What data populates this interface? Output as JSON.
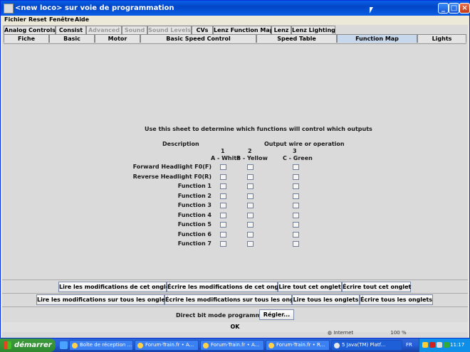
{
  "window": {
    "title": "<new loco> sur voie de programmation",
    "menu": [
      "Fichier",
      "Reset",
      "Fenêtre",
      "Aide"
    ]
  },
  "tabs_row1": [
    {
      "label": "Analog Controls",
      "disabled": false
    },
    {
      "label": "Consist",
      "disabled": false
    },
    {
      "label": "Advanced",
      "disabled": true
    },
    {
      "label": "Sound",
      "disabled": true
    },
    {
      "label": "Sound Levels",
      "disabled": true
    },
    {
      "label": "CVs",
      "disabled": false
    },
    {
      "label": "Lenz Function Map",
      "disabled": false
    },
    {
      "label": "Lenz",
      "disabled": false
    },
    {
      "label": "Lenz Lighting",
      "disabled": false
    }
  ],
  "tabs_row2": [
    {
      "label": "Fiche"
    },
    {
      "label": "Basic"
    },
    {
      "label": "Motor"
    },
    {
      "label": "Basic Speed Control"
    },
    {
      "label": "Speed Table"
    },
    {
      "label": "Function Map",
      "selected": true
    },
    {
      "label": "Lights"
    }
  ],
  "function_map": {
    "instruction": "Use this sheet to determine which functions will control which outputs",
    "description_header": "Description",
    "output_header": "Output wire or operation",
    "columns": [
      {
        "number": "1",
        "label": "A - White"
      },
      {
        "number": "2",
        "label": "B - Yellow"
      },
      {
        "number": "3",
        "label": "C - Green"
      }
    ],
    "rows": [
      {
        "label": "Forward Headlight F0(F)",
        "checks": [
          false,
          false,
          false
        ]
      },
      {
        "label": "Reverse Headlight F0(R)",
        "checks": [
          false,
          false,
          false
        ]
      },
      {
        "label": "Function 1",
        "checks": [
          false,
          false,
          false
        ]
      },
      {
        "label": "Function 2",
        "checks": [
          false,
          false,
          false
        ]
      },
      {
        "label": "Function 3",
        "checks": [
          false,
          false,
          false
        ]
      },
      {
        "label": "Function 4",
        "checks": [
          false,
          false,
          false
        ]
      },
      {
        "label": "Function 5",
        "checks": [
          false,
          false,
          false
        ]
      },
      {
        "label": "Function 6",
        "checks": [
          false,
          false,
          false
        ]
      },
      {
        "label": "Function 7",
        "checks": [
          false,
          false,
          false
        ]
      }
    ]
  },
  "buttons": {
    "row1": [
      "Lire les modifications de cet onglet",
      "Écrire les modifications de cet onglet",
      "Lire tout cet onglet",
      "Écrire tout cet onglet"
    ],
    "row2": [
      "Lire les modifications sur tous les onglets",
      "Écrire les modifications sur tous les onglets",
      "Lire tous les onglets",
      "Écrire tous les onglets"
    ],
    "mode_label": "Direct bit mode programming",
    "regler": "Régler...",
    "ok": "OK"
  },
  "taskbar": {
    "start": "démarrer",
    "tasks": [
      "Boîte de réception ...",
      "Forum-Train.fr • A...",
      "Forum-Train.fr • A...",
      "Forum-Train.fr • R...",
      "5 Java(TM) Platf..."
    ],
    "lang": "FR",
    "clock": "11:17"
  },
  "ie_status": {
    "zone": "Internet",
    "zoom": "100 %"
  }
}
